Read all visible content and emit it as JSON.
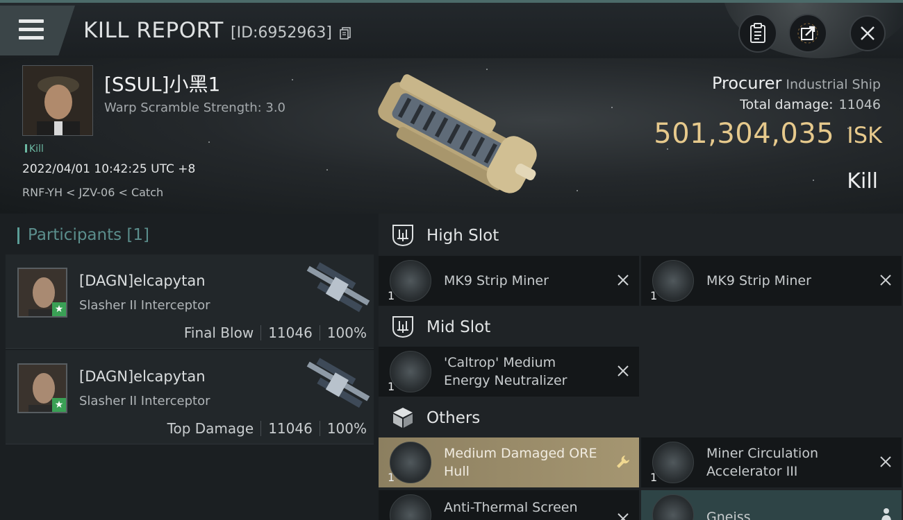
{
  "header": {
    "title": "KILL REPORT",
    "report_id": "[ID:6952963]"
  },
  "victim": {
    "name": "[SSUL]小黑1",
    "warp_scramble": "Warp Scramble Strength: 3.0",
    "kill_tag": "Kill",
    "datetime": "2022/04/01 10:42:25 UTC +8",
    "location": "RNF-YH < JZV-06 < Catch",
    "ship_name": "Procurer",
    "ship_class": "Industrial Ship",
    "total_damage_label": "Total damage:",
    "total_damage": "11046",
    "isk_value": "501,304,035",
    "isk_unit": "ISK",
    "result": "Kill"
  },
  "participants": {
    "header": "Participants [1]",
    "rows": [
      {
        "name": "[DAGN]elcapytan",
        "ship": "Slasher II Interceptor",
        "role": "Final Blow",
        "damage": "11046",
        "percent": "100%"
      },
      {
        "name": "[DAGN]elcapytan",
        "ship": "Slasher II Interceptor",
        "role": "Top Damage",
        "damage": "11046",
        "percent": "100%"
      }
    ]
  },
  "slots": {
    "high": {
      "label": "High Slot",
      "items": [
        {
          "name": "MK9 Strip Miner",
          "qty": "1"
        },
        {
          "name": "MK9 Strip Miner",
          "qty": "1"
        }
      ]
    },
    "mid": {
      "label": "Mid Slot",
      "items": [
        {
          "name": "'Caltrop' Medium Energy Neutralizer",
          "qty": "1"
        }
      ]
    },
    "others": {
      "label": "Others",
      "items": [
        {
          "name": "Medium Damaged ORE Hull",
          "qty": "1",
          "state": "dropped"
        },
        {
          "name": "Miner Circulation Accelerator III",
          "qty": "1"
        },
        {
          "name": "Anti-Thermal Screen",
          "qty": ""
        },
        {
          "name": "Gneiss",
          "qty": ""
        }
      ]
    }
  },
  "colors": {
    "accent_teal": "#5b8e8c",
    "isk_gold": "#e6c98c",
    "dropped_item": "#a59671",
    "kill_tag": "#6cb9a3"
  }
}
